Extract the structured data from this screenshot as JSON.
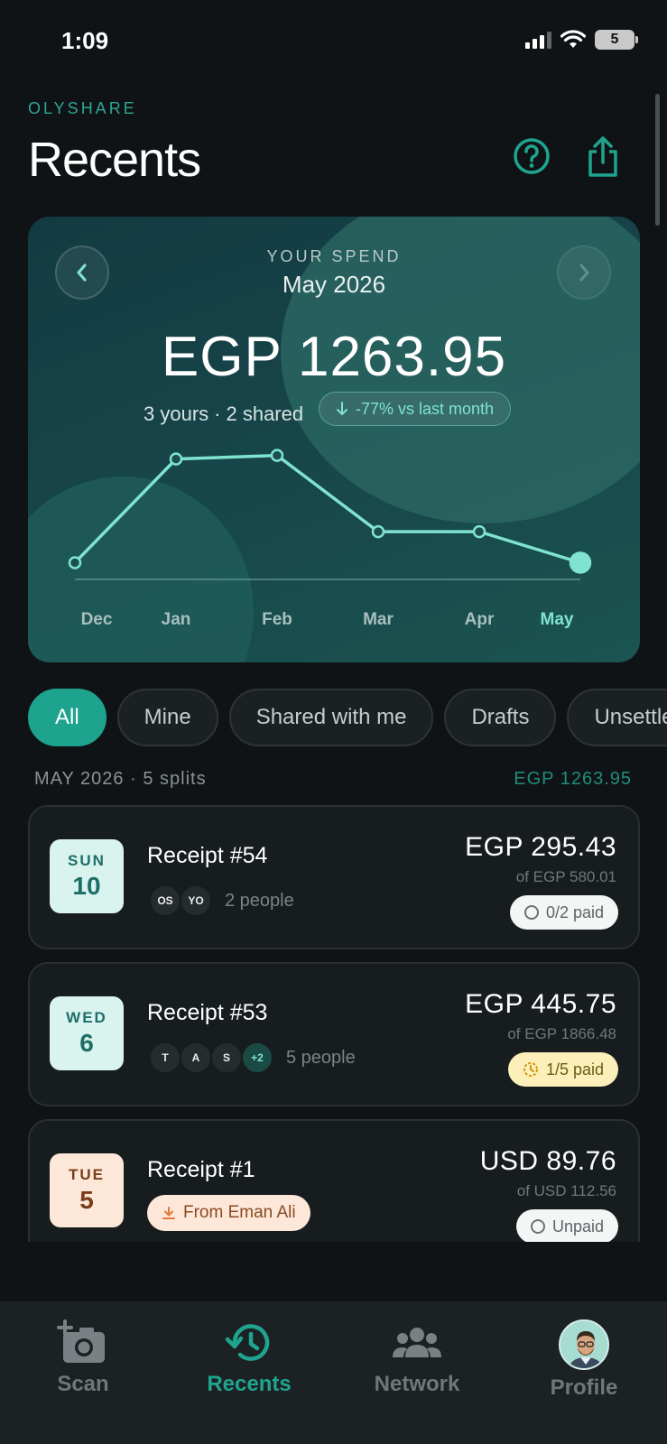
{
  "status_bar": {
    "time": "1:09",
    "battery": "5"
  },
  "header": {
    "brand": "OLYSHARE",
    "title": "Recents"
  },
  "spend": {
    "label": "YOUR SPEND",
    "month": "May 2026",
    "total": "EGP 1263.95",
    "yours": "3 yours",
    "shared": "2 shared",
    "trend": "-77% vs last month"
  },
  "chart_data": {
    "type": "line",
    "categories": [
      "Dec",
      "Jan",
      "Feb",
      "Mar",
      "Apr",
      "May"
    ],
    "values": [
      0.08,
      0.95,
      0.98,
      0.34,
      0.34,
      0.08
    ],
    "highlight": "May",
    "grid": false,
    "colors": {
      "line": "#7fe3d0",
      "baseline": "#5f8f8b"
    }
  },
  "filters": [
    "All",
    "Mine",
    "Shared with me",
    "Drafts",
    "Unsettled"
  ],
  "section": {
    "label": "MAY 2026",
    "count": "5 splits",
    "total": "EGP 1263.95"
  },
  "receipts": [
    {
      "dow": "SUN",
      "day": "10",
      "title": "Receipt #54",
      "avatars": [
        "OS",
        "YO"
      ],
      "people": "2 people",
      "amount": "EGP 295.43",
      "of": "of EGP 580.01",
      "paid": "0/2 paid"
    },
    {
      "dow": "WED",
      "day": "6",
      "title": "Receipt #53",
      "avatars": [
        "T",
        "A",
        "S",
        "+2"
      ],
      "people": "5 people",
      "amount": "EGP 445.75",
      "of": "of EGP 1866.48",
      "paid": "1/5 paid"
    },
    {
      "dow": "TUE",
      "day": "5",
      "title": "Receipt #1",
      "from": "From Eman Ali",
      "amount": "USD 89.76",
      "of": "of USD 112.56",
      "paid": "Unpaid"
    }
  ],
  "tabs": {
    "scan": "Scan",
    "recents": "Recents",
    "network": "Network",
    "profile": "Profile"
  },
  "colors": {
    "accent": "#1da38e",
    "mint": "#7fe3d0",
    "background": "#0f1315"
  }
}
